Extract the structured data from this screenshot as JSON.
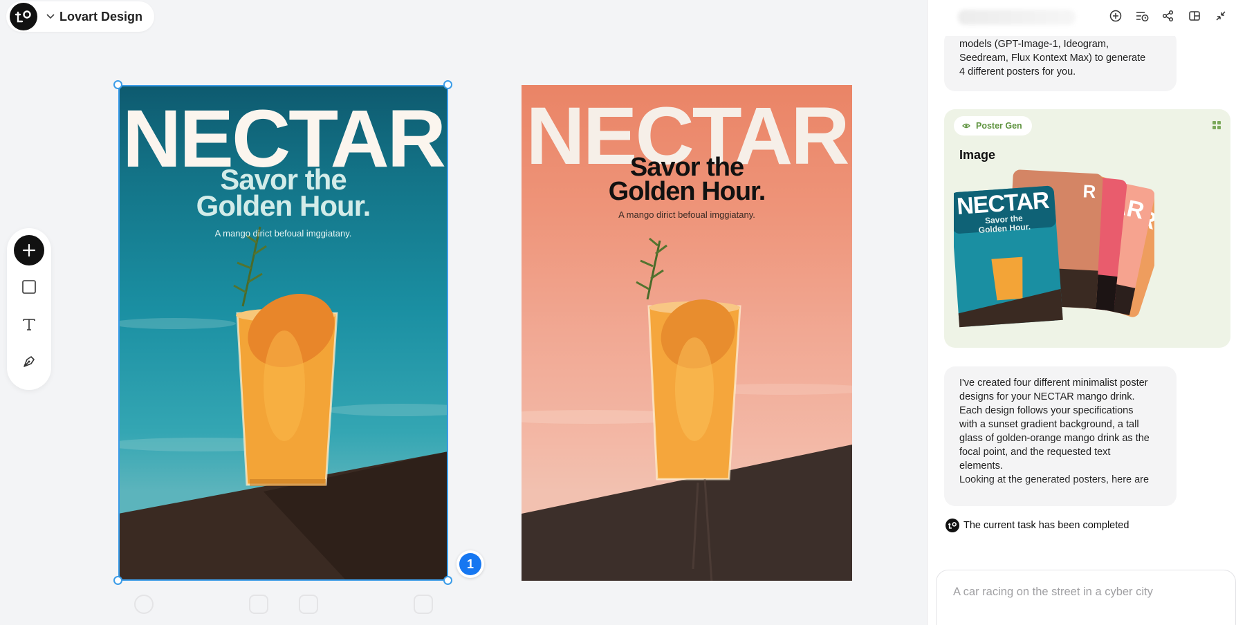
{
  "project": {
    "name": "Lovart Design"
  },
  "toolbar": {
    "items": [
      "add-icon",
      "rectangle-icon",
      "text-icon",
      "pen-icon"
    ]
  },
  "posters": [
    {
      "headline": "NECTAR",
      "tagline_line1": "Savor the",
      "tagline_line2": "Golden Hour.",
      "subtitle": "A mango dirict befoual imggiatany.",
      "colors": {
        "bg_top": "#0e5a6f",
        "bg_bottom": "#5cb4bc",
        "wall": "#3a2a22"
      }
    },
    {
      "headline": "NECTAR",
      "tagline_line1": "Savor the",
      "tagline_line2": "Golden Hour.",
      "subtitle": "A mango dirict befoual imggiatany.",
      "colors": {
        "bg_top": "#ea8466",
        "bg_bottom": "#f2c1b0",
        "wall": "#3c2f2a"
      }
    }
  ],
  "selection": {
    "count": "1",
    "accent": "#3b9ce8"
  },
  "panel": {
    "header_icons": [
      "new-chat-icon",
      "history-icon",
      "share-icon",
      "layout-icon",
      "collapse-icon"
    ],
    "message_1": [
      "models (GPT-Image-1, Ideogram,",
      "Seedream, Flux Kontext Max) to generate",
      "4 different posters for you."
    ],
    "card": {
      "tag": "Poster Gen",
      "title": "Image",
      "mini_headline": "NECTAR",
      "mini_tagline_1": "Savor the",
      "mini_tagline_2": "Golden Hour.",
      "back_letters_1": "R",
      "back_letters_2": "AR",
      "back_letters_3": "R"
    },
    "message_2": [
      "I've created four different minimalist poster",
      "designs for your NECTAR mango drink.",
      "Each design follows your specifications",
      "with a sunset gradient background, a tall",
      "glass of golden-orange mango drink as the",
      "focal point, and the requested text",
      "elements.",
      "Looking at the generated posters, here are"
    ],
    "status": "The current task has been completed",
    "composer_placeholder": "A car racing on the street in a cyber city"
  },
  "colors": {
    "accent_green": "#5f9440",
    "selection_blue": "#3b9ce8",
    "badge_blue": "#1677f1"
  }
}
